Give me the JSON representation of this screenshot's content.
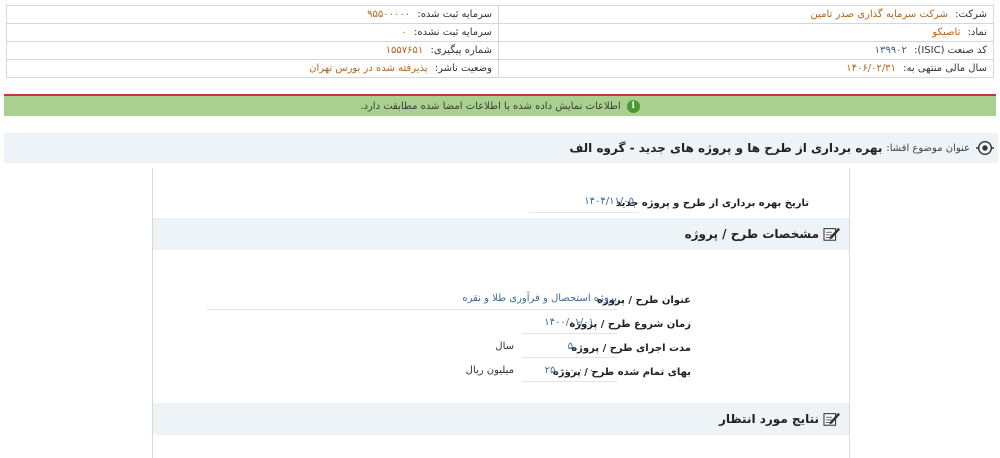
{
  "company_info": {
    "company_label": "شرکت:",
    "company_value": "شرکت سرمایه گذاری صدر تامین",
    "registered_capital_label": "سرمایه ثبت شده:",
    "registered_capital_value": "۹۵۵۰۰۰۰۰",
    "symbol_label": "نماد:",
    "symbol_value": "تاصیکو",
    "unregistered_capital_label": "سرمایه ثبت نشده:",
    "unregistered_capital_value": "۰",
    "isic_label": "کد صنعت (ISIC):",
    "isic_value": "۱۳۹۹۰۲",
    "tracking_label": "شماره پیگیری:",
    "tracking_value": "۱۵۵۷۶۵۱",
    "fiscal_year_label": "سال مالی منتهی به:",
    "fiscal_year_value": "۱۴۰۶/۰۲/۳۱",
    "publisher_status_label": "وضعیت ناشر:",
    "publisher_status_value": "پذیرفته شده در بورس تهران"
  },
  "banner": {
    "message": "اطلاعات نمایش داده شده با اطلاعات امضا شده مطابقت دارد."
  },
  "subject": {
    "label": "عنوان موضوع افشا:",
    "title": "بهره برداری از طرح ها و پروژه های جدید - گروه الف"
  },
  "details": {
    "launch_date_label": "تاریخ بهره برداری از طرح و پروژه جدید",
    "launch_date_value": "۱۴۰۴/۱۱/۰۵",
    "specs_section_title": "مشخصات طرح / پروژه",
    "project_title_label": "عنوان طرح / پروژه",
    "project_title_value": "پروژه استحصال و فرآوری طلا و نقره",
    "start_time_label": "زمان شروع طرح / پروژه",
    "start_time_value": "۱۴۰۰/۰۱/۰۱",
    "duration_label": "مدت اجرای طرح / پروژه",
    "duration_value": "۵",
    "duration_unit": "سال",
    "cost_label": "بهای تمام شده طرح / پروژه",
    "cost_value": "۲۵,۰۰۰,۰۰۰",
    "cost_unit": "میلیون ریال",
    "expected_results_title": "نتایج مورد انتظار"
  }
}
